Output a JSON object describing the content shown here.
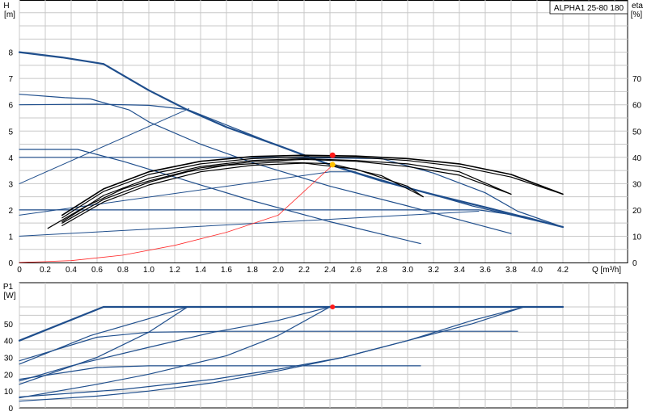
{
  "chart_data": [
    {
      "type": "line",
      "title": "ALPHA1 25-80 180",
      "ylabel_left": "H\n[m]",
      "ylabel_right": "eta\n[%]",
      "xlabel": "Q [m³/h]",
      "xlim": [
        0,
        4.7
      ],
      "ylim_left": [
        0,
        10
      ],
      "ylim_right": [
        0,
        100
      ],
      "grid": true,
      "x_ticks": [
        "0",
        "0.2",
        "0.4",
        "0.6",
        "0.8",
        "1.0",
        "1.2",
        "1.4",
        "1.6",
        "1.8",
        "2.0",
        "2.2",
        "2.4",
        "2.6",
        "2.8",
        "3.0",
        "3.2",
        "3.4",
        "3.6",
        "3.8",
        "4.0",
        "4.2"
      ],
      "y_ticks_left": [
        "0",
        "1",
        "2",
        "3",
        "4",
        "5",
        "6",
        "7",
        "8"
      ],
      "y_ticks_right": [
        "0",
        "10",
        "20",
        "30",
        "40",
        "50",
        "60",
        "70"
      ],
      "series": [
        {
          "kind": "head",
          "color": "#1f4e8c",
          "width": 2.2,
          "x": [
            0,
            0.33,
            0.65,
            1.0,
            1.3,
            1.6,
            2.0,
            2.4,
            2.8,
            3.2,
            3.6,
            4.0,
            4.2
          ],
          "y": [
            8.0,
            7.8,
            7.55,
            6.55,
            5.8,
            5.15,
            4.45,
            3.72,
            3.1,
            2.58,
            2.1,
            1.6,
            1.35
          ]
        },
        {
          "kind": "head",
          "color": "#1f4e8c",
          "width": 1.2,
          "x": [
            0,
            0.35,
            0.55,
            0.85,
            1.0,
            1.4,
            1.8,
            2.4,
            3.0,
            3.8
          ],
          "y": [
            6.4,
            6.27,
            6.22,
            5.8,
            5.35,
            4.5,
            3.8,
            2.9,
            2.15,
            1.1
          ]
        },
        {
          "kind": "head",
          "color": "#1f4e8c",
          "width": 1.2,
          "x": [
            0,
            0.6,
            1.0,
            1.3,
            2.0,
            2.4,
            3.0,
            3.5,
            4.2
          ],
          "y": [
            6.0,
            6.02,
            5.98,
            5.82,
            4.45,
            3.72,
            2.85,
            2.15,
            1.35
          ]
        },
        {
          "kind": "head",
          "color": "#1f4e8c",
          "width": 1.2,
          "x": [
            0,
            0.45,
            0.8,
            1.2,
            1.8,
            2.4,
            3.1
          ],
          "y": [
            4.3,
            4.3,
            3.85,
            3.25,
            2.35,
            1.55,
            0.72
          ]
        },
        {
          "kind": "head",
          "color": "#1f4e8c",
          "width": 1.2,
          "x": [
            0,
            1.0,
            2.0,
            2.8,
            3.2,
            3.6,
            3.85,
            4.2
          ],
          "y": [
            4.0,
            4.0,
            4.0,
            3.95,
            3.4,
            2.65,
            1.95,
            1.35
          ]
        },
        {
          "kind": "head",
          "color": "#1f4e8c",
          "width": 1.2,
          "x": [
            0,
            1.0,
            2.0,
            3.0,
            3.55,
            3.9,
            4.2
          ],
          "y": [
            2.0,
            2.0,
            2.0,
            2.0,
            2.0,
            1.75,
            1.35
          ]
        },
        {
          "kind": "system",
          "color": "#1f4e8c",
          "width": 1.0,
          "x": [
            0,
            1.31
          ],
          "y": [
            3.0,
            5.85
          ]
        },
        {
          "kind": "system",
          "color": "#1f4e8c",
          "width": 1.0,
          "x": [
            0,
            2.4,
            2.6
          ],
          "y": [
            1.8,
            3.45,
            3.45
          ]
        },
        {
          "kind": "system",
          "color": "#1f4e8c",
          "width": 1.0,
          "x": [
            0,
            3.55
          ],
          "y": [
            1.0,
            1.95
          ]
        },
        {
          "kind": "system",
          "color": "#ff2a2a",
          "width": 0.8,
          "x": [
            0,
            0.4,
            0.8,
            1.2,
            1.6,
            2.0,
            2.42
          ],
          "y": [
            0,
            0.07,
            0.28,
            0.65,
            1.15,
            1.8,
            3.7
          ]
        },
        {
          "kind": "eta",
          "color": "#000000",
          "width": 1.6,
          "x": [
            0.33,
            0.65,
            1.0,
            1.4,
            1.8,
            2.2,
            2.6,
            3.0,
            3.4,
            3.8,
            4.2
          ],
          "y": [
            18,
            28,
            34.5,
            38.5,
            40.3,
            40.8,
            40.5,
            39.5,
            37.5,
            33.5,
            26
          ]
        },
        {
          "kind": "eta",
          "color": "#000000",
          "width": 1.2,
          "x": [
            0.33,
            0.65,
            1.0,
            1.4,
            1.8,
            2.2,
            2.6,
            3.0,
            3.4,
            3.8,
            4.2
          ],
          "y": [
            17,
            27,
            33.5,
            37.5,
            39.5,
            40.2,
            40,
            38.8,
            36.5,
            32.5,
            26
          ]
        },
        {
          "kind": "eta",
          "color": "#000000",
          "width": 1.2,
          "x": [
            0.33,
            0.65,
            1.0,
            1.4,
            1.8,
            2.2,
            2.6,
            3.0,
            3.4,
            3.8
          ],
          "y": [
            15.5,
            25.5,
            32,
            36.5,
            38.8,
            39.5,
            38.8,
            37.5,
            34.5,
            26
          ]
        },
        {
          "kind": "eta",
          "color": "#000000",
          "width": 1.2,
          "x": [
            0.22,
            0.5,
            0.8,
            1.0,
            1.4,
            1.8,
            2.2,
            2.6,
            3.0,
            3.4,
            3.8
          ],
          "y": [
            13,
            21,
            28,
            31,
            36,
            38.3,
            39.2,
            38.5,
            36.5,
            33.2,
            26
          ]
        },
        {
          "kind": "eta",
          "color": "#000000",
          "width": 1.2,
          "x": [
            0.33,
            0.65,
            1.0,
            1.4,
            1.8,
            2.2,
            2.6,
            3.0,
            3.12
          ],
          "y": [
            14,
            23,
            29.5,
            34.5,
            37,
            37.8,
            35.5,
            29,
            25
          ]
        },
        {
          "kind": "eta",
          "color": "#000000",
          "width": 1.2,
          "x": [
            0.33,
            0.65,
            1.0,
            1.3,
            1.6,
            2.0,
            2.4,
            2.8,
            3.12
          ],
          "y": [
            15,
            24,
            30.5,
            34.5,
            37,
            38.2,
            37.6,
            33,
            25
          ]
        }
      ],
      "points": [
        {
          "x": 2.42,
          "y": 4.08,
          "color": "#ff1a1a"
        },
        {
          "x": 2.42,
          "y": 3.72,
          "color": "#ffc000"
        }
      ]
    },
    {
      "type": "line",
      "ylabel": "P1\n[W]",
      "xlim": [
        0,
        4.7
      ],
      "ylim": [
        0,
        60
      ],
      "grid": true,
      "y_ticks": [
        "0",
        "10",
        "20",
        "30",
        "40",
        "50"
      ],
      "series": [
        {
          "color": "#1f4e8c",
          "width": 2.2,
          "x": [
            0,
            0.65,
            1.0,
            2.4,
            3.6,
            4.2
          ],
          "y": [
            40,
            60,
            60,
            60,
            60,
            60
          ]
        },
        {
          "color": "#1f4e8c",
          "width": 1.2,
          "x": [
            0,
            0.55,
            1.0,
            1.3
          ],
          "y": [
            26,
            43,
            53,
            60
          ]
        },
        {
          "color": "#1f4e8c",
          "width": 1.2,
          "x": [
            0,
            0.6,
            1.0,
            1.3
          ],
          "y": [
            14,
            30,
            45,
            60
          ]
        },
        {
          "color": "#1f4e8c",
          "width": 1.2,
          "x": [
            0,
            0.4,
            1.0,
            1.5,
            2.0,
            2.4,
            2.6
          ],
          "y": [
            16,
            25,
            36,
            45,
            52,
            60,
            60
          ]
        },
        {
          "color": "#1f4e8c",
          "width": 1.2,
          "x": [
            0,
            0.6,
            1.0,
            1.6,
            2.0,
            2.8,
            3.55,
            3.85
          ],
          "y": [
            28,
            42,
            45,
            45.5,
            45.5,
            45.5,
            45.5,
            45.5
          ]
        },
        {
          "color": "#1f4e8c",
          "width": 1.2,
          "x": [
            0,
            0.6,
            1.0,
            1.6,
            2.0,
            2.4,
            2.8,
            3.1
          ],
          "y": [
            17,
            24,
            25,
            25,
            25,
            25,
            25,
            25
          ]
        },
        {
          "color": "#1f4e8c",
          "width": 1.2,
          "x": [
            0,
            0.6,
            1.0,
            1.6,
            2.0,
            2.4
          ],
          "y": [
            6,
            14,
            20,
            31,
            43,
            60
          ]
        },
        {
          "color": "#1f4e8c",
          "width": 1.2,
          "x": [
            0,
            0.8,
            1.5,
            2.0,
            2.5,
            3.0,
            3.5,
            3.9,
            4.2
          ],
          "y": [
            6.5,
            11,
            17,
            23,
            30,
            40,
            50,
            60,
            60
          ]
        },
        {
          "color": "#1f4e8c",
          "width": 1.2,
          "x": [
            0,
            0.6,
            1.0,
            1.5,
            2.0,
            2.5,
            3.0,
            3.5,
            3.9,
            4.2
          ],
          "y": [
            4,
            7,
            10,
            15,
            22,
            30,
            40,
            52,
            60,
            60
          ]
        }
      ],
      "points": [
        {
          "x": 2.42,
          "y": 60,
          "color": "#ff1a1a"
        }
      ]
    }
  ]
}
